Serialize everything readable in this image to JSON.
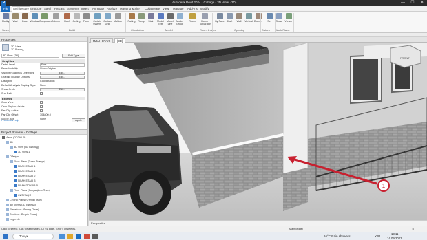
{
  "window": {
    "title": "Autodesk Revit 2024 - Cottage - 3D View: {3D}",
    "logo": "R",
    "controls": [
      "—",
      "☐",
      "✕"
    ]
  },
  "ribbon_tabs": [
    "File",
    "Architecture",
    "Structure",
    "Steel",
    "Precast",
    "Systems",
    "Insert",
    "Annotate",
    "Analyze",
    "Massing & Site",
    "Collaborate",
    "View",
    "Manage",
    "Add-Ins",
    "Modify"
  ],
  "ribbon": {
    "buttons": [
      {
        "label": "Modify",
        "icon": "arrow-cursor-icon"
      },
      {
        "label": "Wall",
        "icon": "wall-icon"
      },
      {
        "label": "Door",
        "icon": "door-icon"
      },
      {
        "label": "Window",
        "icon": "window-icon"
      },
      {
        "label": "Component",
        "icon": "component-icon"
      },
      {
        "label": "Column",
        "icon": "column-icon"
      },
      {
        "label": "Roof",
        "icon": "roof-icon"
      },
      {
        "label": "Ceiling",
        "icon": "ceiling-icon"
      },
      {
        "label": "Floor",
        "icon": "floor-icon"
      },
      {
        "label": "Curtain System",
        "icon": "curtain-system-icon"
      },
      {
        "label": "Curtain Grid",
        "icon": "curtain-grid-icon"
      },
      {
        "label": "Mullion",
        "icon": "mullion-icon"
      },
      {
        "label": "Railing",
        "icon": "railing-icon"
      },
      {
        "label": "Ramp",
        "icon": "ramp-icon"
      },
      {
        "label": "Stair",
        "icon": "stair-icon"
      },
      {
        "label": "Model Text",
        "icon": "model-text-icon"
      },
      {
        "label": "Model Line",
        "icon": "model-line-icon"
      },
      {
        "label": "Model Group",
        "icon": "model-group-icon"
      },
      {
        "label": "Room",
        "icon": "room-icon"
      },
      {
        "label": "Room Separator",
        "icon": "room-separator-icon"
      },
      {
        "label": "By Face",
        "icon": "by-face-icon"
      },
      {
        "label": "Shaft",
        "icon": "shaft-icon"
      },
      {
        "label": "Wall",
        "icon": "opening-wall-icon"
      },
      {
        "label": "Vertical",
        "icon": "vertical-opening-icon"
      },
      {
        "label": "Dormer",
        "icon": "dormer-icon"
      },
      {
        "label": "Set",
        "icon": "set-workplane-icon"
      },
      {
        "label": "Show",
        "icon": "show-workplane-icon"
      },
      {
        "label": "Viewer",
        "icon": "viewer-icon"
      }
    ],
    "groups": [
      "Select",
      "Build",
      "Circulation",
      "Model",
      "Room & Area",
      "Opening",
      "Datum",
      "Work Plane"
    ]
  },
  "properties": {
    "title": "Properties",
    "type_name": "3D View",
    "type_sub": "3D Вигляд",
    "selector": "3D View: {3D}",
    "edit_type": "Edit Type",
    "section_graphics": "Graphics",
    "rows": [
      {
        "k": "Detail Level",
        "v": "Fine",
        "kind": "box"
      },
      {
        "k": "Parts Visibility",
        "v": "Show Original",
        "kind": "text"
      },
      {
        "k": "Visibility/Graphics Overrides",
        "v": "Edit...",
        "kind": "btn"
      },
      {
        "k": "Graphic Display Options",
        "v": "Edit...",
        "kind": "btn"
      },
      {
        "k": "Discipline",
        "v": "Coordination",
        "kind": "text"
      },
      {
        "k": "Default Analysis Display Style",
        "v": "None",
        "kind": "text"
      },
      {
        "k": "Show Grids",
        "v": "Edit...",
        "kind": "btn"
      },
      {
        "k": "Sun Path",
        "v": "",
        "kind": "chk"
      }
    ],
    "section_extents": "Extents",
    "extent_rows": [
      {
        "k": "Crop View",
        "v": "",
        "kind": "chk"
      },
      {
        "k": "Crop Region Visible",
        "v": "",
        "kind": "chk"
      },
      {
        "k": "Far Clip Active",
        "v": "",
        "kind": "chk"
      },
      {
        "k": "Far Clip Offset",
        "v": "304800.0",
        "kind": "text"
      },
      {
        "k": "Scope Box",
        "v": "None",
        "kind": "text"
      }
    ],
    "help_link": "Properties help",
    "apply": "Apply"
  },
  "browser": {
    "title": "Project Browser - Cottage",
    "nodes": [
      {
        "t": "Views (ГОЛА Ц5)",
        "d": 0
      },
      {
        "t": "3D",
        "d": 1
      },
      {
        "t": "3D View (3D Вигляд)",
        "d": 2
      },
      {
        "t": "3D View 1",
        "d": 3
      },
      {
        "t": "Обмірні",
        "d": 1
      },
      {
        "t": "Floor Plans (План Поверх)",
        "d": 2
      },
      {
        "t": "ПЛАН ЕТАЖ 1",
        "d": 3
      },
      {
        "t": "ПЛАН ЕТАЖ 1",
        "d": 3
      },
      {
        "t": "ПЛАН ЕТАЖ 2",
        "d": 3
      },
      {
        "t": "ПЛАН ЕТАЖ 3",
        "d": 3
      },
      {
        "t": "ПЛАН ПОКРІВЛІ",
        "d": 3
      },
      {
        "t": "Floor Plans (Ситуаційна План)",
        "d": 2
      },
      {
        "t": "СИТУАЦІЯ",
        "d": 3
      },
      {
        "t": "Ceiling Plans (Стеля План)",
        "d": 1
      },
      {
        "t": "3D Views (3D Вигляд)",
        "d": 1
      },
      {
        "t": "Elevations (Фасад План)",
        "d": 1
      },
      {
        "t": "Sections (Розріз План)",
        "d": 1
      },
      {
        "t": "Legends",
        "d": 1
      }
    ]
  },
  "view_tabs": [
    {
      "label": "ПЛАН ЕТАЖ",
      "active": false
    },
    {
      "label": "{3D}",
      "active": true
    }
  ],
  "viewport": {
    "callout_number": "1",
    "scale": "Perspective",
    "viewcube": "FRONT"
  },
  "status": {
    "hint": "Click to select, TAB for alternates, CTRL adds, SHIFT unselects.",
    "main_model": "Main Model",
    "zero": ":0"
  },
  "taskbar": {
    "search": "Пошук",
    "weather": "16°C  Rain showers",
    "lang": "УКР",
    "time": "13:11",
    "date": "14.09.2023"
  },
  "colors": {
    "accent": "#1b6ec2",
    "arrow": "#c8202f",
    "titlebar": "#2b2b2b"
  }
}
